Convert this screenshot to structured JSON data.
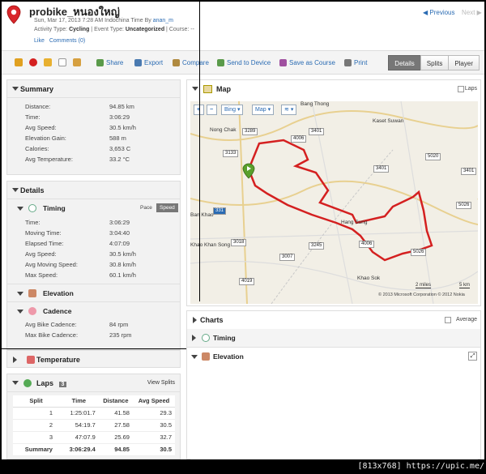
{
  "header": {
    "title": "probike_หนองใหญ่",
    "date_line_prefix": "Sun, Mar 17, 2013 7:28 AM Indochina Time By ",
    "author": "anan_m",
    "activity_type_label": "Activity Type:",
    "activity_type": "Cycling",
    "event_type_label": "Event Type:",
    "event_type": "Uncategorized",
    "course_label": "Course:",
    "course_value": "--",
    "like": "Like",
    "comments": "Comments (0)",
    "prev": "◀ Previous",
    "next": "Next ▶"
  },
  "toolbar": {
    "share": "Share",
    "export": "Export",
    "compare": "Compare",
    "send": "Send to Device",
    "save_course": "Save as Course",
    "print": "Print",
    "tabs": [
      "Details",
      "Splits",
      "Player"
    ]
  },
  "summary": {
    "title": "Summary",
    "rows": [
      {
        "label": "Distance:",
        "value": "94.85 km"
      },
      {
        "label": "Time:",
        "value": "3:06:29"
      },
      {
        "label": "Avg Speed:",
        "value": "30.5 km/h"
      },
      {
        "label": "Elevation Gain:",
        "value": "588 m"
      },
      {
        "label": "Calories:",
        "value": "3,653 C"
      },
      {
        "label": "Avg Temperature:",
        "value": "33.2 °C"
      }
    ]
  },
  "details": {
    "title": "Details",
    "timing": {
      "title": "Timing",
      "pace": "Pace",
      "speed": "Speed",
      "rows": [
        {
          "label": "Time:",
          "value": "3:06:29"
        },
        {
          "label": "Moving Time:",
          "value": "3:04:40"
        },
        {
          "label": "Elapsed Time:",
          "value": "4:07:09"
        },
        {
          "label": "Avg Speed:",
          "value": "30.5 km/h"
        },
        {
          "label": "Avg Moving Speed:",
          "value": "30.8 km/h"
        },
        {
          "label": "Max Speed:",
          "value": "60.1 km/h"
        }
      ]
    },
    "elevation": {
      "title": "Elevation"
    },
    "cadence": {
      "title": "Cadence",
      "rows": [
        {
          "label": "Avg Bike Cadence:",
          "value": "84 rpm"
        },
        {
          "label": "Max Bike Cadence:",
          "value": "235 rpm"
        }
      ]
    },
    "temperature": {
      "title": "Temperature"
    }
  },
  "laps": {
    "title": "Laps",
    "count": "3",
    "view_splits": "View Splits",
    "columns": [
      "Split",
      "Time",
      "Distance",
      "Avg Speed"
    ],
    "rows": [
      [
        "1",
        "1:25:01.7",
        "41.58",
        "29.3"
      ],
      [
        "2",
        "54:19.7",
        "27.58",
        "30.5"
      ],
      [
        "3",
        "47:07.9",
        "25.69",
        "32.7"
      ]
    ],
    "summary": [
      "Summary",
      "3:06:29.4",
      "94.85",
      "30.5"
    ]
  },
  "map": {
    "title": "Map",
    "laps_label": "Laps",
    "bing": "Bing",
    "map_type": "Map",
    "scale_mi": "2 miles",
    "scale_km": "5 km",
    "copyright": "© 2013 Microsoft Corporation   © 2012 Nokia",
    "towns": [
      "Nong Chak",
      "Kaset Suwan",
      "Hang Sung",
      "Khao Khan Song",
      "Khao Sok",
      "Ban Khao",
      "Bang Thong"
    ],
    "roads": [
      "3289",
      "3133",
      "4006",
      "3401",
      "3245",
      "331",
      "3018",
      "3007",
      "4019",
      "4006",
      "3401",
      "5020",
      "3401",
      "5026",
      "5026"
    ]
  },
  "charts": {
    "title": "Charts",
    "average": "Average",
    "timing": "Timing",
    "elevation": "Elevation"
  },
  "badge": "[813x768] https://upic.me/",
  "colors": {
    "link": "#2a6bb3",
    "route": "#d42020",
    "active_tab": "#777777"
  }
}
